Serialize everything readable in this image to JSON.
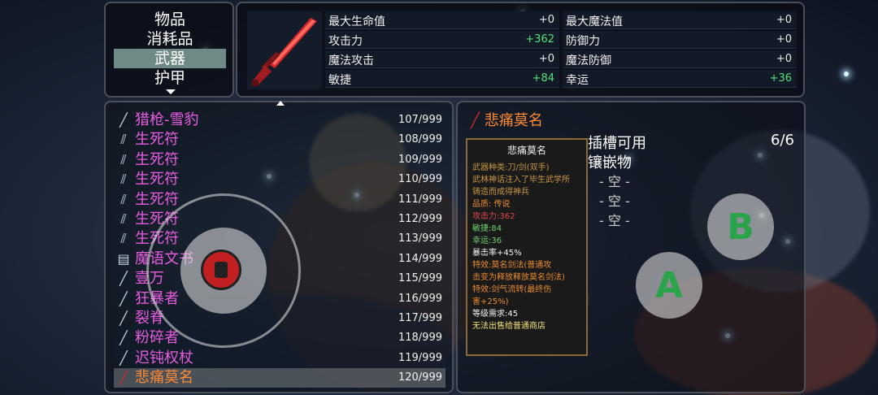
{
  "categories": {
    "items": [
      "物品",
      "消耗品",
      "武器",
      "护甲"
    ],
    "selected_index": 2
  },
  "stats": {
    "left": [
      {
        "label": "最大生命值",
        "value": "+0",
        "highlight": false
      },
      {
        "label": "攻击力",
        "value": "+362",
        "highlight": true
      },
      {
        "label": "魔法攻击",
        "value": "+0",
        "highlight": false
      },
      {
        "label": "敏捷",
        "value": "+84",
        "highlight": true
      }
    ],
    "right": [
      {
        "label": "最大魔法值",
        "value": "+0",
        "highlight": false
      },
      {
        "label": "防御力",
        "value": "+0",
        "highlight": false
      },
      {
        "label": "魔法防御",
        "value": "+0",
        "highlight": false
      },
      {
        "label": "幸运",
        "value": "+36",
        "highlight": true
      }
    ]
  },
  "items": [
    {
      "name": "猎枪-雪豹",
      "count": "107/999",
      "color": "#e85de0",
      "icon": "gun-icon",
      "glyph": "╱"
    },
    {
      "name": "生死符",
      "count": "108/999",
      "color": "#e85de0",
      "icon": "needles-icon",
      "glyph": "⫽"
    },
    {
      "name": "生死符",
      "count": "109/999",
      "color": "#e85de0",
      "icon": "needles-icon",
      "glyph": "⫽"
    },
    {
      "name": "生死符",
      "count": "110/999",
      "color": "#e85de0",
      "icon": "needles-icon",
      "glyph": "⫽"
    },
    {
      "name": "生死符",
      "count": "111/999",
      "color": "#e85de0",
      "icon": "needles-icon",
      "glyph": "⫽"
    },
    {
      "name": "生死符",
      "count": "112/999",
      "color": "#e85de0",
      "icon": "needles-icon",
      "glyph": "⫽"
    },
    {
      "name": "生死符",
      "count": "113/999",
      "color": "#e85de0",
      "icon": "needles-icon",
      "glyph": "⫽"
    },
    {
      "name": "魔语文书",
      "count": "114/999",
      "color": "#e85de0",
      "icon": "book-icon",
      "glyph": "▤"
    },
    {
      "name": "壹万",
      "count": "115/999",
      "color": "#e85de0",
      "icon": "sword-icon",
      "glyph": "╱"
    },
    {
      "name": "狂暴者",
      "count": "116/999",
      "color": "#e85de0",
      "icon": "syringe-icon",
      "glyph": "╱"
    },
    {
      "name": "裂脊",
      "count": "117/999",
      "color": "#e85de0",
      "icon": "dagger-icon",
      "glyph": "╱"
    },
    {
      "name": "粉碎者",
      "count": "118/999",
      "color": "#e85de0",
      "icon": "hammer-icon",
      "glyph": "╱"
    },
    {
      "name": "迟钝权杖",
      "count": "119/999",
      "color": "#e85de0",
      "icon": "staff-icon",
      "glyph": "╱"
    },
    {
      "name": "悲痛莫名",
      "count": "120/999",
      "color": "#ff8a34",
      "icon": "red-sword-icon",
      "glyph": "╱"
    }
  ],
  "selected_item_index": 13,
  "detail": {
    "title": "悲痛莫名",
    "desc_title": "悲痛莫名",
    "lines": [
      {
        "text": "武器种类:刀/剑(双手)",
        "cls": "c-brown"
      },
      {
        "text": "武林神话注入了毕生武学所",
        "cls": "c-brown"
      },
      {
        "text": "铸造而成得神兵",
        "cls": "c-brown"
      },
      {
        "text": "品质: 传说",
        "cls": "c-orange"
      },
      {
        "text": "攻击力:362",
        "cls": "c-red"
      },
      {
        "text": "敏捷:84",
        "cls": "c-green"
      },
      {
        "text": "幸运:36",
        "cls": "c-green"
      },
      {
        "text": "暴击率+45%",
        "cls": "c-white"
      },
      {
        "text": "特效:莫名剑法(普通攻",
        "cls": "c-orange"
      },
      {
        "text": "击变为释放释放莫名剑法)",
        "cls": "c-orange"
      },
      {
        "text": "特效:剑气流转(最终伤",
        "cls": "c-orange"
      },
      {
        "text": "害+25%)",
        "cls": "c-orange"
      },
      {
        "text": "等级需求:45",
        "cls": "c-white"
      },
      {
        "text": "无法出售给普通商店",
        "cls": "c-yellow"
      }
    ],
    "socket_label_1": "插槽可用",
    "socket_label_2": "镶嵌物",
    "socket_count": "6/6",
    "slots": [
      "- 空 -",
      "- 空 -",
      "- 空 -"
    ]
  },
  "buttons": {
    "a": "A",
    "b": "B"
  }
}
